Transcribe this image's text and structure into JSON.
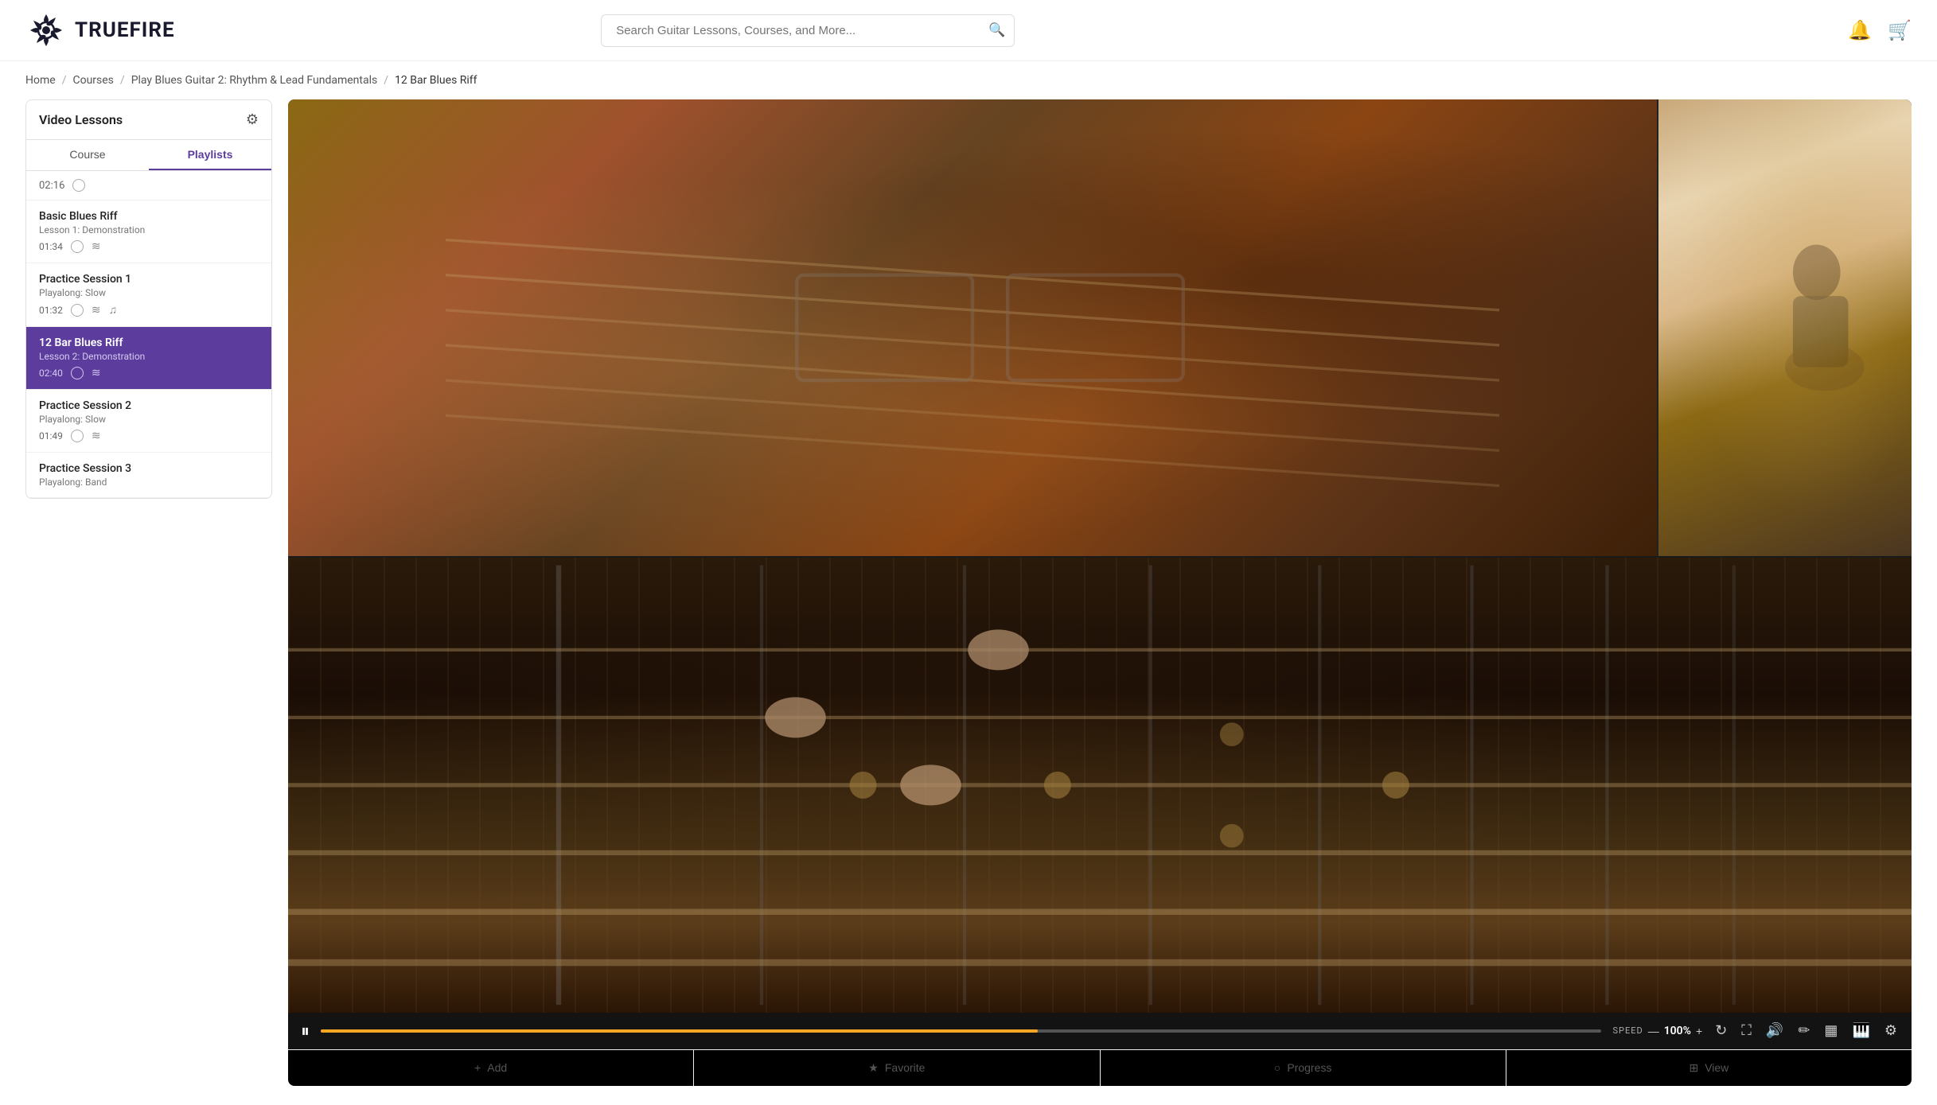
{
  "site": {
    "name": "TRUEFIRE",
    "logo_alt": "TrueFire Logo"
  },
  "header": {
    "search_placeholder": "Search Guitar Lessons, Courses, and More...",
    "notification_label": "Notifications",
    "cart_label": "Cart"
  },
  "breadcrumb": {
    "items": [
      "Home",
      "Courses",
      "Play Blues Guitar 2: Rhythm & Lead Fundamentals",
      "12 Bar Blues Riff"
    ]
  },
  "sidebar": {
    "title": "Video Lessons",
    "tabs": [
      "Course",
      "Playlists"
    ],
    "active_tab": "Playlists",
    "lessons": [
      {
        "id": "intro",
        "title": "",
        "subtitle": "",
        "duration": "02:16",
        "has_circle": true,
        "has_notes": false,
        "has_music": false,
        "active": false
      },
      {
        "id": "basic-blues-riff",
        "title": "Basic Blues Riff",
        "subtitle": "Lesson 1: Demonstration",
        "duration": "01:34",
        "has_circle": true,
        "has_notes": true,
        "has_music": false,
        "active": false
      },
      {
        "id": "practice-session-1",
        "title": "Practice Session 1",
        "subtitle": "Playalong: Slow",
        "duration": "01:32",
        "has_circle": true,
        "has_notes": true,
        "has_music": true,
        "active": false
      },
      {
        "id": "12-bar-blues-riff",
        "title": "12 Bar Blues Riff",
        "subtitle": "Lesson 2: Demonstration",
        "duration": "02:40",
        "has_circle": true,
        "has_notes": true,
        "has_music": false,
        "active": true
      },
      {
        "id": "practice-session-2",
        "title": "Practice Session 2",
        "subtitle": "Playalong: Slow",
        "duration": "01:49",
        "has_circle": true,
        "has_notes": true,
        "has_music": false,
        "active": false
      },
      {
        "id": "practice-session-3",
        "title": "Practice Session 3",
        "subtitle": "Playalong: Band",
        "duration": "",
        "has_circle": false,
        "has_notes": false,
        "has_music": false,
        "active": false
      }
    ]
  },
  "video": {
    "progress_percent": 56,
    "speed_label": "SPEED",
    "speed_value": "100%",
    "speed_minus": "—",
    "speed_plus": "+",
    "is_playing": true
  },
  "bottom_actions": {
    "buttons": [
      {
        "id": "add",
        "label": "Add",
        "icon": "+"
      },
      {
        "id": "favorite",
        "label": "Favorite",
        "icon": "★"
      },
      {
        "id": "progress",
        "label": "Progress",
        "icon": "○"
      },
      {
        "id": "view",
        "label": "View",
        "icon": "⊞"
      }
    ]
  },
  "icons": {
    "search": "🔍",
    "notification": "🔔",
    "cart": "🛒",
    "gear": "⚙",
    "play": "▶",
    "pause": "⏸",
    "repeat": "↻",
    "fullscreen": "⛶",
    "volume": "🔊",
    "edit": "✏",
    "grid": "▦",
    "piano": "🎹",
    "settings": "⚙",
    "notes": "≋",
    "music": "♫"
  },
  "colors": {
    "brand_purple": "#5c3d9e",
    "accent_orange": "#f5a623",
    "dark_bg": "#1a1a1a"
  }
}
